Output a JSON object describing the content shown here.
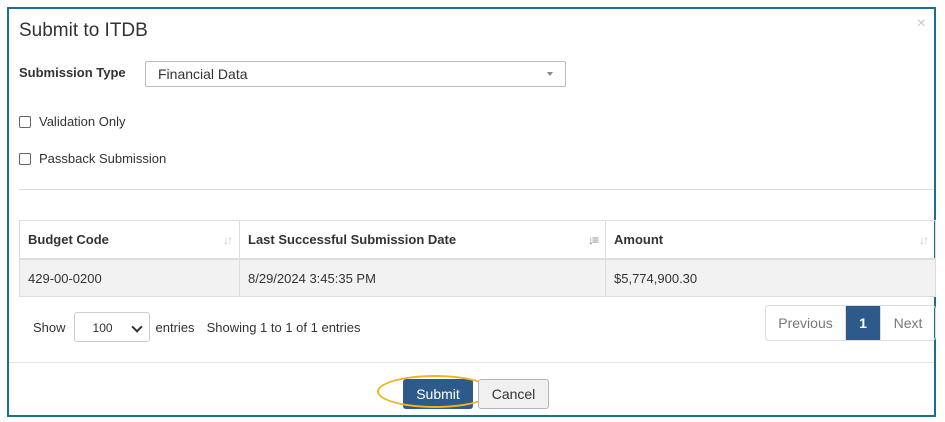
{
  "dialog": {
    "title": "Submit to ITDB",
    "close_glyph": "×"
  },
  "form": {
    "submission_type_label": "Submission Type",
    "submission_type_value": "Financial Data",
    "validation_only_label": "Validation Only",
    "passback_label": "Passback Submission"
  },
  "table": {
    "headers": [
      "Budget Code",
      "Last Successful Submission Date",
      "Amount"
    ],
    "rows": [
      [
        "429-00-0200",
        "8/29/2024 3:45:35 PM",
        "$5,774,900.30"
      ]
    ]
  },
  "length": {
    "show_label": "Show",
    "value": "100",
    "entries_label": "entries"
  },
  "info": "Showing 1 to 1 of 1 entries",
  "pager": {
    "previous": "Previous",
    "current": "1",
    "next": "Next"
  },
  "footer": {
    "submit_label": "Submit",
    "cancel_label": "Cancel"
  },
  "colors": {
    "primary": "#2d5a8a",
    "frame_border": "#1a6f8a",
    "highlight": "#f0b323"
  },
  "icons": {
    "sort": "sort-icon",
    "sort_active": "sort-desc-icon",
    "close": "close-icon",
    "caret": "caret-down-icon"
  }
}
